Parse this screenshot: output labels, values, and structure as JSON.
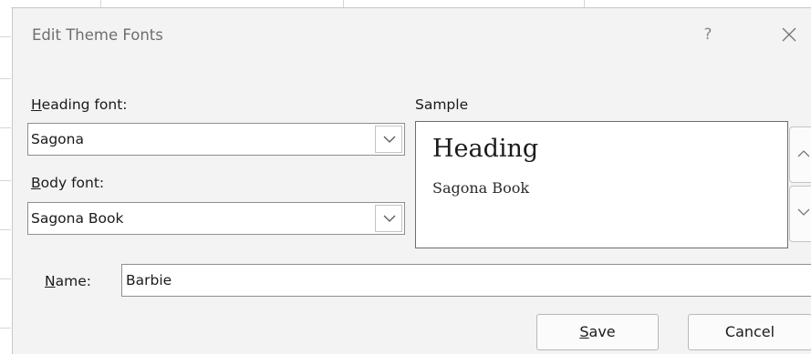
{
  "dialog": {
    "title": "Edit Theme Fonts",
    "help_glyph": "?",
    "close_icon": "close-icon"
  },
  "heading_font": {
    "label_hotkey": "H",
    "label_rest": "eading font:",
    "value": "Sagona"
  },
  "body_font": {
    "label_hotkey": "B",
    "label_rest": "ody font:",
    "value": "Sagona Book"
  },
  "sample": {
    "label": "Sample",
    "heading_text": "Heading",
    "body_text": "Sagona Book"
  },
  "name": {
    "label_hotkey": "N",
    "label_rest": "ame:",
    "value": "Barbie"
  },
  "buttons": {
    "save_hotkey": "S",
    "save_rest": "ave",
    "cancel": "Cancel"
  },
  "icons": {
    "dropdown": "chevron-down-icon",
    "scroll_up": "chevron-up-icon",
    "scroll_down": "chevron-down-icon"
  },
  "colors": {
    "dialog_bg": "#f3f3f3",
    "title_text": "#6e6e6e",
    "border": "#8f8f8f"
  }
}
